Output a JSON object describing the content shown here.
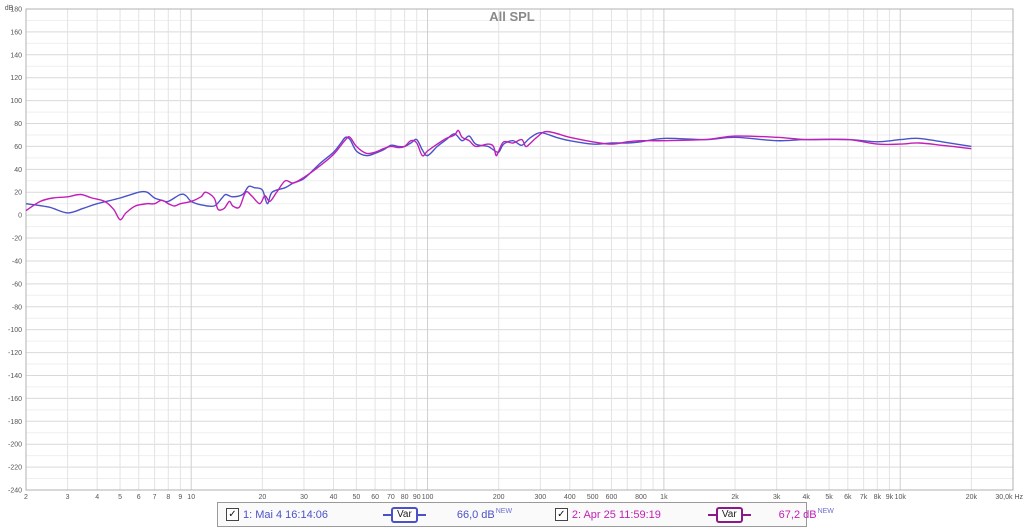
{
  "colors": {
    "series1": "#4b52c8",
    "series2": "#c21fb8",
    "grid": "#d9d9d9",
    "text": "#555555"
  },
  "chart_data": {
    "type": "line",
    "title": "All SPL",
    "ylabel": "dB",
    "xlabel": "Hz",
    "x_scale": "log",
    "xlim": [
      2,
      30000
    ],
    "ylim": [
      -240,
      180
    ],
    "grid": true,
    "y_ticks": [
      180,
      160,
      140,
      120,
      100,
      80,
      60,
      40,
      20,
      0,
      -20,
      -40,
      -60,
      -80,
      -100,
      -120,
      -140,
      -160,
      -180,
      -200,
      -220,
      -240
    ],
    "x_tick_labels": [
      {
        "value": 2,
        "label": "2"
      },
      {
        "value": 3,
        "label": "3"
      },
      {
        "value": 4,
        "label": "4"
      },
      {
        "value": 5,
        "label": "5"
      },
      {
        "value": 6,
        "label": "6"
      },
      {
        "value": 7,
        "label": "7"
      },
      {
        "value": 8,
        "label": "8"
      },
      {
        "value": 9,
        "label": "9"
      },
      {
        "value": 10,
        "label": "10"
      },
      {
        "value": 20,
        "label": "20"
      },
      {
        "value": 30,
        "label": "30"
      },
      {
        "value": 40,
        "label": "40"
      },
      {
        "value": 50,
        "label": "50"
      },
      {
        "value": 60,
        "label": "60"
      },
      {
        "value": 70,
        "label": "70"
      },
      {
        "value": 80,
        "label": "80"
      },
      {
        "value": 90,
        "label": "90"
      },
      {
        "value": 100,
        "label": "100"
      },
      {
        "value": 200,
        "label": "200"
      },
      {
        "value": 300,
        "label": "300"
      },
      {
        "value": 400,
        "label": "400"
      },
      {
        "value": 500,
        "label": "500"
      },
      {
        "value": 600,
        "label": "600"
      },
      {
        "value": 800,
        "label": "800"
      },
      {
        "value": 1000,
        "label": "1k"
      },
      {
        "value": 2000,
        "label": "2k"
      },
      {
        "value": 3000,
        "label": "3k"
      },
      {
        "value": 4000,
        "label": "4k"
      },
      {
        "value": 5000,
        "label": "5k"
      },
      {
        "value": 6000,
        "label": "6k"
      },
      {
        "value": 7000,
        "label": "7k"
      },
      {
        "value": 8000,
        "label": "8k"
      },
      {
        "value": 9000,
        "label": "9k"
      },
      {
        "value": 10000,
        "label": "10k"
      },
      {
        "value": 20000,
        "label": "20k"
      },
      {
        "value": 30000,
        "label": "30,0k Hz"
      }
    ],
    "series": [
      {
        "name": "1: Mai 4 16:14:06",
        "color": "#4b52c8",
        "points": [
          [
            2,
            10
          ],
          [
            2.5,
            7
          ],
          [
            3,
            2
          ],
          [
            3.5,
            6
          ],
          [
            4,
            10
          ],
          [
            5,
            15
          ],
          [
            6,
            20
          ],
          [
            6.5,
            20
          ],
          [
            7,
            15
          ],
          [
            7.5,
            13
          ],
          [
            8,
            12
          ],
          [
            9,
            18
          ],
          [
            9.5,
            17
          ],
          [
            10,
            12
          ],
          [
            11,
            9
          ],
          [
            12.5,
            8
          ],
          [
            13.5,
            15
          ],
          [
            14,
            18
          ],
          [
            15,
            16
          ],
          [
            16.5,
            18
          ],
          [
            17.5,
            25
          ],
          [
            18.5,
            24
          ],
          [
            20,
            22
          ],
          [
            21,
            10
          ],
          [
            22,
            20
          ],
          [
            25,
            24
          ],
          [
            27,
            28
          ],
          [
            30,
            32
          ],
          [
            35,
            45
          ],
          [
            40,
            55
          ],
          [
            43,
            63
          ],
          [
            45,
            68
          ],
          [
            47,
            66
          ],
          [
            50,
            56
          ],
          [
            55,
            52
          ],
          [
            60,
            54
          ],
          [
            65,
            57
          ],
          [
            70,
            61
          ],
          [
            75,
            60
          ],
          [
            80,
            60
          ],
          [
            85,
            63
          ],
          [
            90,
            66
          ],
          [
            95,
            57
          ],
          [
            100,
            52
          ],
          [
            110,
            60
          ],
          [
            120,
            66
          ],
          [
            130,
            71
          ],
          [
            140,
            65
          ],
          [
            150,
            69
          ],
          [
            160,
            62
          ],
          [
            180,
            60
          ],
          [
            190,
            57
          ],
          [
            200,
            55
          ],
          [
            210,
            62
          ],
          [
            230,
            65
          ],
          [
            250,
            61
          ],
          [
            270,
            67
          ],
          [
            300,
            72
          ],
          [
            350,
            68
          ],
          [
            400,
            65
          ],
          [
            500,
            62
          ],
          [
            600,
            63
          ],
          [
            700,
            63
          ],
          [
            800,
            64
          ],
          [
            1000,
            67
          ],
          [
            1500,
            66
          ],
          [
            2000,
            68
          ],
          [
            3000,
            65
          ],
          [
            4000,
            66
          ],
          [
            6000,
            66
          ],
          [
            8000,
            64
          ],
          [
            10000,
            66
          ],
          [
            12000,
            67
          ],
          [
            15000,
            64
          ],
          [
            20000,
            60
          ]
        ]
      },
      {
        "name": "2: Apr 25 11:59:19",
        "color": "#c21fb8",
        "points": [
          [
            2,
            4
          ],
          [
            2.3,
            12
          ],
          [
            2.6,
            15
          ],
          [
            3,
            16
          ],
          [
            3.4,
            18
          ],
          [
            3.8,
            15
          ],
          [
            4.3,
            12
          ],
          [
            4.7,
            5
          ],
          [
            5,
            -4
          ],
          [
            5.3,
            2
          ],
          [
            5.8,
            8
          ],
          [
            6.5,
            10
          ],
          [
            7,
            10
          ],
          [
            7.5,
            13
          ],
          [
            8,
            10
          ],
          [
            8.5,
            8
          ],
          [
            9,
            10
          ],
          [
            10,
            12
          ],
          [
            11,
            16
          ],
          [
            11.5,
            20
          ],
          [
            12.5,
            15
          ],
          [
            13,
            5
          ],
          [
            13.8,
            6
          ],
          [
            14.5,
            12
          ],
          [
            15,
            8
          ],
          [
            16,
            7
          ],
          [
            17,
            20
          ],
          [
            18,
            17
          ],
          [
            19.5,
            10
          ],
          [
            20.5,
            17
          ],
          [
            21.5,
            12
          ],
          [
            23,
            20
          ],
          [
            25,
            30
          ],
          [
            27,
            28
          ],
          [
            30,
            33
          ],
          [
            35,
            43
          ],
          [
            40,
            53
          ],
          [
            45,
            66
          ],
          [
            47,
            68
          ],
          [
            50,
            60
          ],
          [
            55,
            54
          ],
          [
            60,
            55
          ],
          [
            65,
            58
          ],
          [
            70,
            60
          ],
          [
            75,
            59
          ],
          [
            80,
            60
          ],
          [
            85,
            65
          ],
          [
            90,
            63
          ],
          [
            95,
            52
          ],
          [
            100,
            56
          ],
          [
            110,
            62
          ],
          [
            120,
            67
          ],
          [
            130,
            70
          ],
          [
            135,
            74
          ],
          [
            140,
            68
          ],
          [
            150,
            65
          ],
          [
            160,
            60
          ],
          [
            180,
            62
          ],
          [
            190,
            60
          ],
          [
            195,
            52
          ],
          [
            200,
            56
          ],
          [
            210,
            64
          ],
          [
            230,
            63
          ],
          [
            250,
            66
          ],
          [
            260,
            60
          ],
          [
            270,
            62
          ],
          [
            290,
            68
          ],
          [
            320,
            73
          ],
          [
            400,
            68
          ],
          [
            500,
            64
          ],
          [
            600,
            62
          ],
          [
            700,
            64
          ],
          [
            800,
            65
          ],
          [
            1000,
            65
          ],
          [
            1500,
            66
          ],
          [
            2000,
            69
          ],
          [
            3000,
            68
          ],
          [
            4000,
            66
          ],
          [
            6000,
            66
          ],
          [
            8000,
            62
          ],
          [
            10000,
            62
          ],
          [
            12000,
            63
          ],
          [
            15000,
            61
          ],
          [
            20000,
            58
          ]
        ]
      }
    ]
  },
  "legend": {
    "entries": [
      {
        "check": "✓",
        "name": "1: Mai 4 16:14:06",
        "var_label": "Var",
        "level": "66,0 dB",
        "level_sup": "NEW",
        "color": "#4b52c8"
      },
      {
        "check": "✓",
        "name": "2: Apr 25 11:59:19",
        "var_label": "Var",
        "level": "67,2 dB",
        "level_sup": "NEW",
        "color": "#c21fb8"
      }
    ]
  }
}
